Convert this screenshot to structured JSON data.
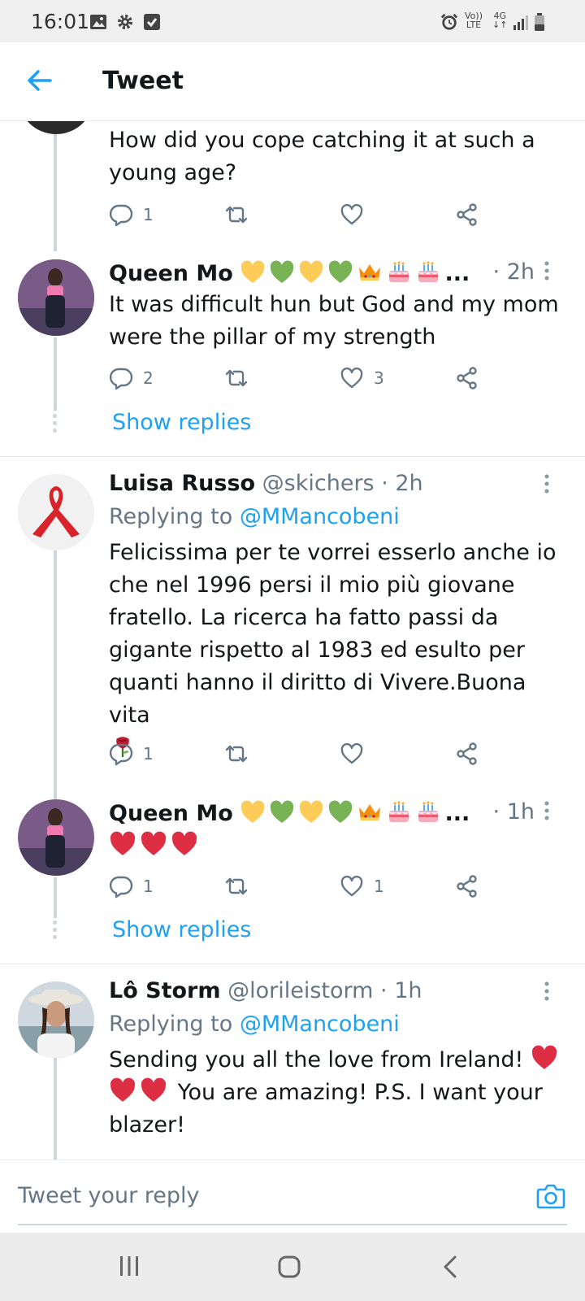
{
  "status_bar": {
    "time": "16:01",
    "net_top": "Vo))",
    "net_bottom": "LTE",
    "gen": "4G"
  },
  "header": {
    "title": "Tweet"
  },
  "tweets": [
    {
      "text": "How did you cope catching it at such a young age?",
      "actions": {
        "reply_count": "1",
        "like_count": ""
      }
    },
    {
      "name": "Queen Mo",
      "ellipsis": "...",
      "time": "· 2h",
      "text": "It was difficult hun but God and my mom were the pillar of my strength",
      "actions": {
        "reply_count": "2",
        "like_count": "3"
      },
      "show_replies": "Show replies"
    },
    {
      "name": "Luisa Russo",
      "handle": "@skichers · 2h",
      "replying_prefix": "Replying to ",
      "replying_to": "@MMancobeni",
      "text": "Felicissima per te vorrei esserlo anche io che nel 1996 persi il mio più giovane fratello. La ricerca ha fatto passi da gigante rispetto al 1983 ed esulto per quanti hanno il diritto di Vivere.Buona vita",
      "actions": {
        "reply_count": "1",
        "like_count": ""
      }
    },
    {
      "name": "Queen Mo",
      "ellipsis": "...",
      "time": "· 1h",
      "actions": {
        "reply_count": "1",
        "like_count": "1"
      },
      "show_replies": "Show replies"
    },
    {
      "name": "Lô Storm",
      "handle": "@lorileistorm · 1h",
      "replying_prefix": "Replying to ",
      "replying_to": "@MMancobeni",
      "text_a": "Sending you all the love from Ireland!",
      "text_b": "You are amazing! P.S. I want your blazer!"
    }
  ],
  "reply_bar": {
    "placeholder": "Tweet your reply"
  },
  "colors": {
    "accent": "#1da1f2",
    "secondary_text": "#657786",
    "heart_emoji": "#dd2e44",
    "divider": "#e6ecf0"
  },
  "icons": [
    "back-arrow-icon",
    "reply-icon",
    "retweet-icon",
    "like-icon",
    "share-icon",
    "more-icon",
    "camera-icon"
  ]
}
